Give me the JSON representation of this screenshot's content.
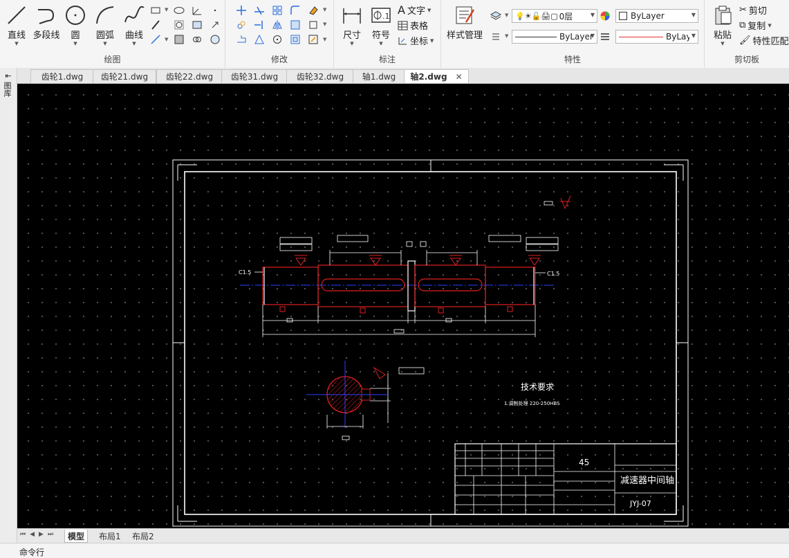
{
  "ribbon": {
    "draw": {
      "title": "绘图",
      "line": "直线",
      "polyline": "多段线",
      "circle": "圆",
      "arc": "圆弧",
      "curve": "曲线"
    },
    "modify": {
      "title": "修改"
    },
    "annotation": {
      "title": "标注",
      "dimension": "尺寸",
      "symbol": "符号",
      "text": "文字",
      "table": "表格",
      "coordinate": "坐标"
    },
    "properties": {
      "title": "特性",
      "style_manager": "样式管理",
      "layer_value": "0层",
      "color_value": "ByLayer",
      "linetype_value": "ByLayer",
      "lineweight_value": "ByLayer"
    },
    "clipboard": {
      "title": "剪切板",
      "paste": "粘贴",
      "cut": "剪切",
      "copy": "复制",
      "match": "特性匹配"
    }
  },
  "file_tabs": [
    "齿轮1.dwg",
    "齿轮21.dwg",
    "齿轮22.dwg",
    "齿轮31.dwg",
    "齿轮32.dwg",
    "轴1.dwg",
    "轴2.dwg"
  ],
  "active_tab": "轴2.dwg",
  "left_panel_label": "图库",
  "drawing": {
    "chamfer_left": "C1.5",
    "chamfer_right": "C1.5",
    "tech_title": "技术要求",
    "tech_note": "1.调制处理 220-250HBS",
    "material": "45",
    "part_name": "减速器中间轴",
    "drawing_no": "JYJ-07"
  },
  "layout_tabs": {
    "model": "模型",
    "layout1": "布局1",
    "layout2": "布局2"
  },
  "command_prompt": "命令行",
  "colors": {
    "bylayer_line": "#e03030",
    "drawing_red": "#e02020",
    "center_blue": "#2a40ff",
    "canvas_bg": "#000000"
  }
}
